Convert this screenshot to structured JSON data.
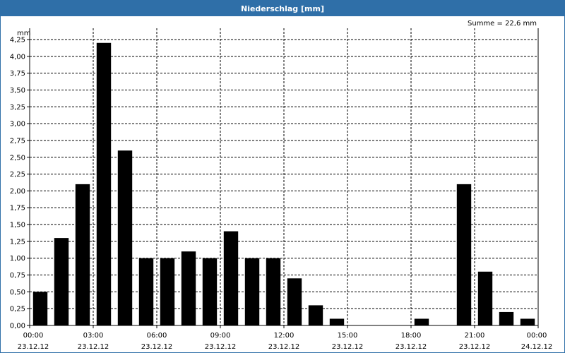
{
  "window": {
    "title": "Niederschlag [mm]"
  },
  "chart_data": {
    "type": "bar",
    "unit_label": "mm",
    "annotation": "Summe = 22,6 mm",
    "ylim": [
      0,
      4.25
    ],
    "yticks": [
      "0,00",
      "0,25",
      "0,50",
      "0,75",
      "1,00",
      "1,25",
      "1,50",
      "1,75",
      "2,00",
      "2,25",
      "2,50",
      "2,75",
      "3,00",
      "3,25",
      "3,50",
      "3,75",
      "4,00",
      "4,25"
    ],
    "xticks": [
      {
        "time": "00:00",
        "date": "23.12.12"
      },
      {
        "time": "03:00",
        "date": "23.12.12"
      },
      {
        "time": "06:00",
        "date": "23.12.12"
      },
      {
        "time": "09:00",
        "date": "23.12.12"
      },
      {
        "time": "12:00",
        "date": "23.12.12"
      },
      {
        "time": "15:00",
        "date": "23.12.12"
      },
      {
        "time": "18:00",
        "date": "23.12.12"
      },
      {
        "time": "21:00",
        "date": "23.12.12"
      },
      {
        "time": "00:00",
        "date": "24.12.12"
      }
    ],
    "interval_hours": 1,
    "grid": true,
    "bar_color": "#000000",
    "values": [
      0.5,
      1.3,
      2.1,
      4.2,
      2.6,
      1.0,
      1.0,
      1.1,
      1.0,
      1.4,
      1.0,
      1.0,
      0.7,
      0.3,
      0.1,
      0,
      0,
      0,
      0.1,
      0,
      2.1,
      0.8,
      0.2,
      0.1
    ]
  }
}
